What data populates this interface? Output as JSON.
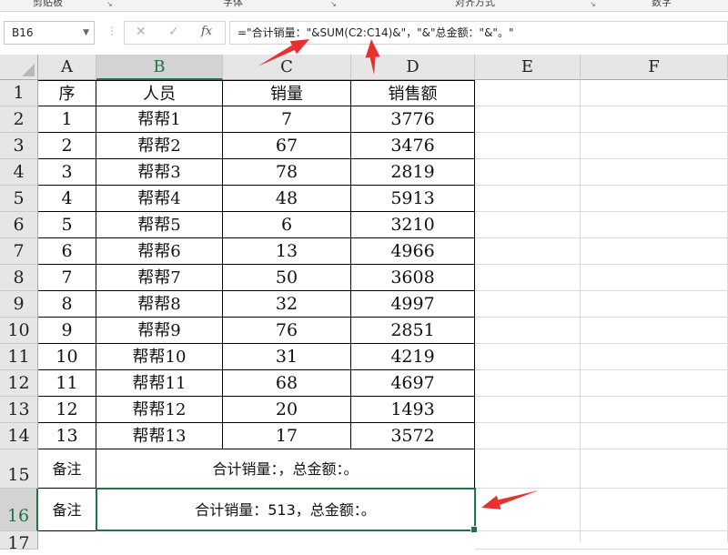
{
  "ribbon": {
    "groups": [
      "剪贴板",
      "字体",
      "对齐方式",
      "数字"
    ]
  },
  "formula_bar": {
    "name_box": "B16",
    "cancel_icon": "✕",
    "enter_icon": "✓",
    "fx_label": "fx",
    "formula": "=\"合计销量：\"&SUM(C2:C14)&\"，\"&\"总金额：\"&\"。\""
  },
  "columns": [
    "A",
    "B",
    "C",
    "D",
    "E",
    "F"
  ],
  "selected_cell": "B16",
  "rows": [
    {
      "num": "1",
      "cells": [
        "序",
        "人员",
        "销量",
        "销售额"
      ]
    },
    {
      "num": "2",
      "cells": [
        "1",
        "帮帮1",
        "7",
        "3776"
      ]
    },
    {
      "num": "3",
      "cells": [
        "2",
        "帮帮2",
        "67",
        "3476"
      ]
    },
    {
      "num": "4",
      "cells": [
        "3",
        "帮帮3",
        "78",
        "2819"
      ]
    },
    {
      "num": "5",
      "cells": [
        "4",
        "帮帮4",
        "48",
        "5913"
      ]
    },
    {
      "num": "6",
      "cells": [
        "5",
        "帮帮5",
        "6",
        "3210"
      ]
    },
    {
      "num": "7",
      "cells": [
        "6",
        "帮帮6",
        "13",
        "4966"
      ]
    },
    {
      "num": "8",
      "cells": [
        "7",
        "帮帮7",
        "50",
        "3608"
      ]
    },
    {
      "num": "9",
      "cells": [
        "8",
        "帮帮8",
        "32",
        "4997"
      ]
    },
    {
      "num": "10",
      "cells": [
        "9",
        "帮帮9",
        "76",
        "2851"
      ]
    },
    {
      "num": "11",
      "cells": [
        "10",
        "帮帮10",
        "31",
        "4219"
      ]
    },
    {
      "num": "12",
      "cells": [
        "11",
        "帮帮11",
        "68",
        "4697"
      ]
    },
    {
      "num": "13",
      "cells": [
        "12",
        "帮帮12",
        "20",
        "1493"
      ]
    },
    {
      "num": "14",
      "cells": [
        "13",
        "帮帮13",
        "17",
        "3572"
      ]
    }
  ],
  "notes": [
    {
      "num": "15",
      "label": "备注",
      "text": "合计销量：，总金额：。"
    },
    {
      "num": "16",
      "label": "备注",
      "text": "合计销量：513，总金额：。"
    }
  ],
  "row17": "17",
  "annotation_color": "#e8312f",
  "accent_color": "#217346"
}
